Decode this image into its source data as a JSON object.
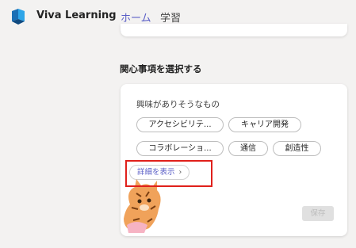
{
  "app": {
    "title": "Viva Learning",
    "logo_icon": "viva-learning-logo-icon"
  },
  "tabs": [
    {
      "label": "ホーム",
      "selected": true
    },
    {
      "label": "学習",
      "selected": false
    }
  ],
  "interests": {
    "heading": "関心事項を選択する",
    "card_label": "興味がありそうなもの",
    "chips": [
      {
        "label": "アクセシビリテ..."
      },
      {
        "label": "キャリア開発"
      },
      {
        "label": "コラボレーショ..."
      },
      {
        "label": "通信"
      },
      {
        "label": "創造性"
      }
    ],
    "show_more_label": "詳細を表示",
    "show_more_icon": "chevron-right-icon",
    "save_label": "保存",
    "mascot_icon": "tiger-mascot-illustration"
  },
  "colors": {
    "accent": "#5b5fc7",
    "highlight": "#e0201b",
    "background": "#f3f2f1"
  }
}
